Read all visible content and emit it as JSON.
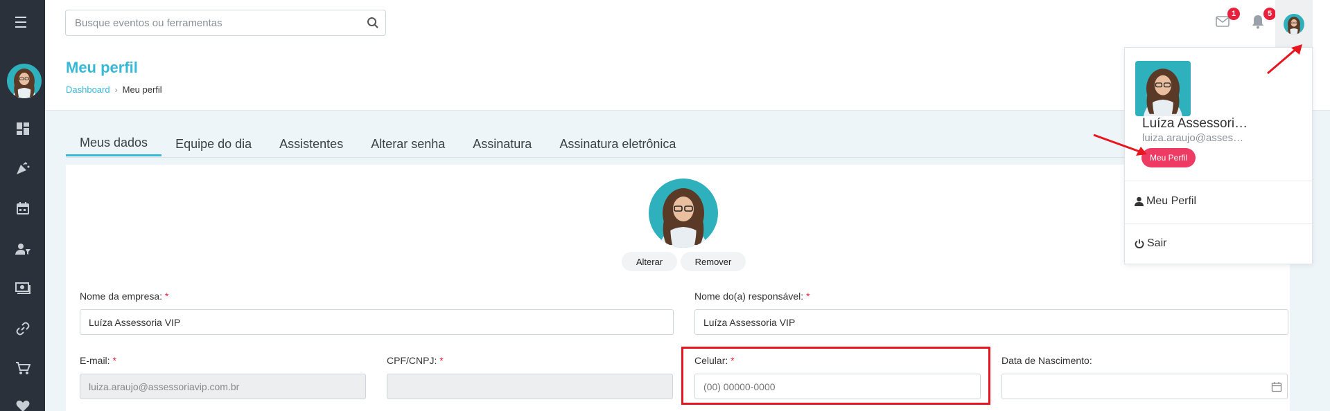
{
  "search": {
    "placeholder": "Busque eventos ou ferramentas"
  },
  "notifications": {
    "messages_count": "1",
    "alerts_count": "5"
  },
  "page": {
    "title": "Meu perfil",
    "breadcrumb": {
      "home": "Dashboard",
      "separator": "›",
      "current": "Meu perfil"
    }
  },
  "tabs": [
    "Meus dados",
    "Equipe do dia",
    "Assistentes",
    "Alterar senha",
    "Assinatura",
    "Assinatura eletrônica"
  ],
  "photo": {
    "change_label": "Alterar",
    "remove_label": "Remover"
  },
  "form": {
    "required_mark": "*",
    "company": {
      "label": "Nome da empresa:",
      "value": "Luíza Assessoria VIP"
    },
    "responsible": {
      "label": "Nome do(a) responsável:",
      "value": "Luíza Assessoria VIP"
    },
    "email": {
      "label": "E-mail:",
      "value": "luiza.araujo@assessoriavip.com.br"
    },
    "cpf": {
      "label": "CPF/CNPJ:",
      "value": ""
    },
    "phone": {
      "label": "Celular:",
      "placeholder": "(00) 00000-0000"
    },
    "birth": {
      "label": "Data de Nascimento:",
      "value": ""
    }
  },
  "dropdown": {
    "name": "Luíza Assessoria VIP",
    "email": "luiza.araujo@assessoriavip.com.br",
    "pill_label": "Meu Perfil",
    "profile_label": "Meu Perfil",
    "logout_label": "Sair"
  },
  "colors": {
    "accent": "#36b8d6",
    "sidebar": "#2b313b",
    "badge": "#e8203c",
    "pill": "#ee3b63",
    "highlight": "#e8151e"
  }
}
